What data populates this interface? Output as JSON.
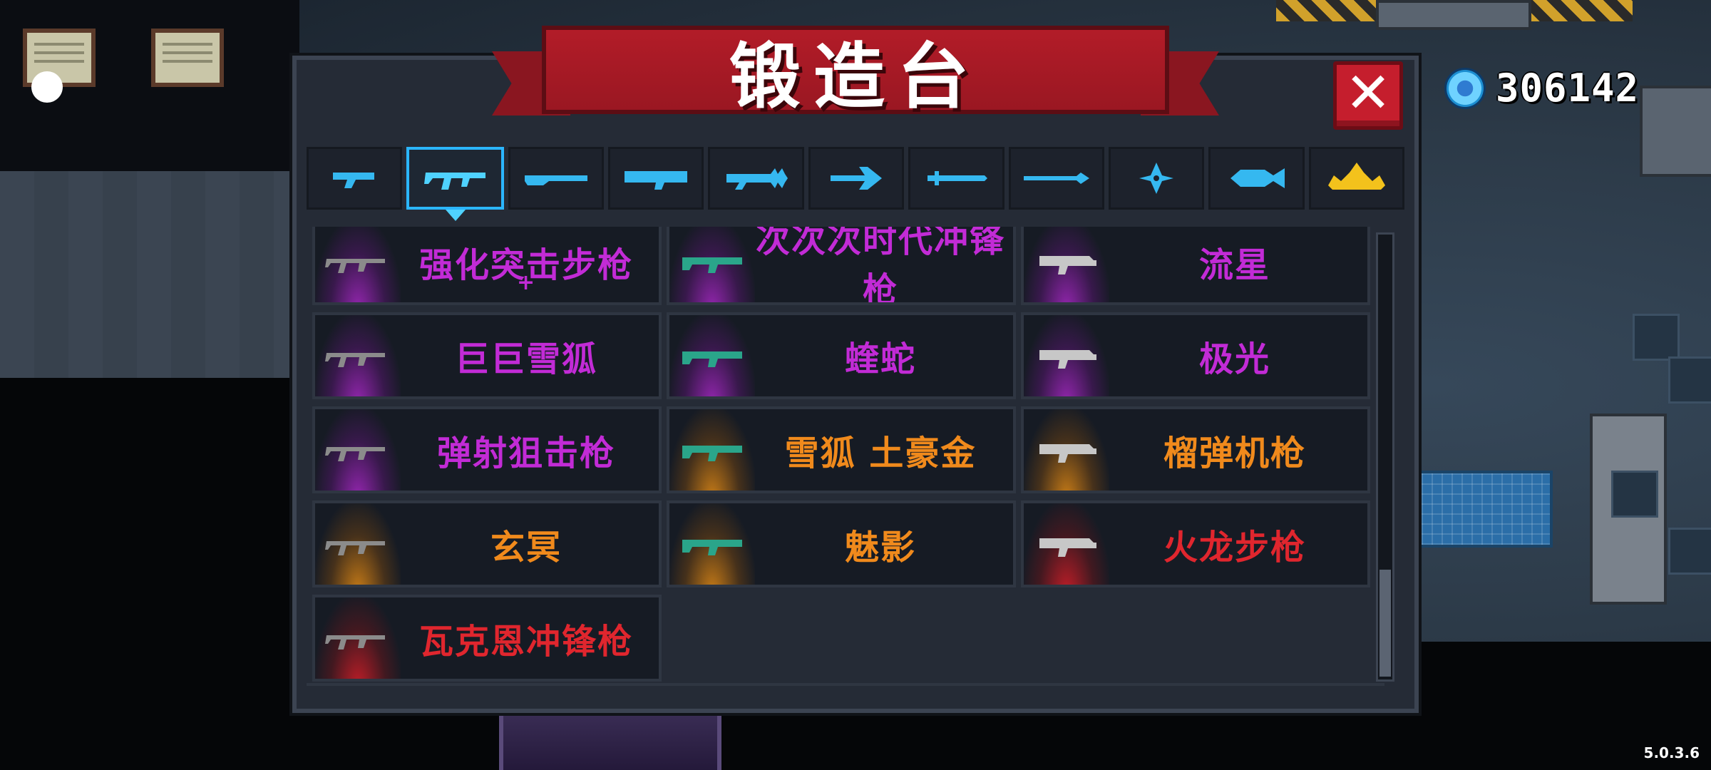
{
  "forge": {
    "title": "锻造台",
    "close_icon": "close-icon",
    "currency": {
      "icon": "gem-icon",
      "value": "306142"
    },
    "tabs": [
      {
        "name": "pistol",
        "active": false
      },
      {
        "name": "rifle",
        "active": true
      },
      {
        "name": "shotgun",
        "active": false
      },
      {
        "name": "launcher",
        "active": false
      },
      {
        "name": "laser",
        "active": false
      },
      {
        "name": "bow",
        "active": false
      },
      {
        "name": "melee",
        "active": false
      },
      {
        "name": "spear",
        "active": false
      },
      {
        "name": "throwing",
        "active": false
      },
      {
        "name": "other",
        "active": false
      },
      {
        "name": "crown",
        "active": false
      }
    ],
    "weapons": [
      {
        "name": "强化突击步枪",
        "rarity": "purple",
        "plus": "+"
      },
      {
        "name": "次次次时代冲锋枪",
        "rarity": "purple"
      },
      {
        "name": "流星",
        "rarity": "purple"
      },
      {
        "name": "巨巨雪狐",
        "rarity": "purple"
      },
      {
        "name": "蝰蛇",
        "rarity": "purple"
      },
      {
        "name": "极光",
        "rarity": "purple"
      },
      {
        "name": "弹射狙击枪",
        "rarity": "purple"
      },
      {
        "name": "雪狐 土豪金",
        "rarity": "orange"
      },
      {
        "name": "榴弹机枪",
        "rarity": "orange"
      },
      {
        "name": "玄冥",
        "rarity": "orange"
      },
      {
        "name": "魅影",
        "rarity": "orange"
      },
      {
        "name": "火龙步枪",
        "rarity": "red"
      },
      {
        "name": "瓦克恩冲锋枪",
        "rarity": "red"
      }
    ],
    "scroll_position": 0.85,
    "colors": {
      "accent": "#2bb6ff",
      "purple": "#c22bd6",
      "orange": "#f08a1c",
      "red": "#e0262e"
    }
  },
  "version": "5.0.3.6"
}
